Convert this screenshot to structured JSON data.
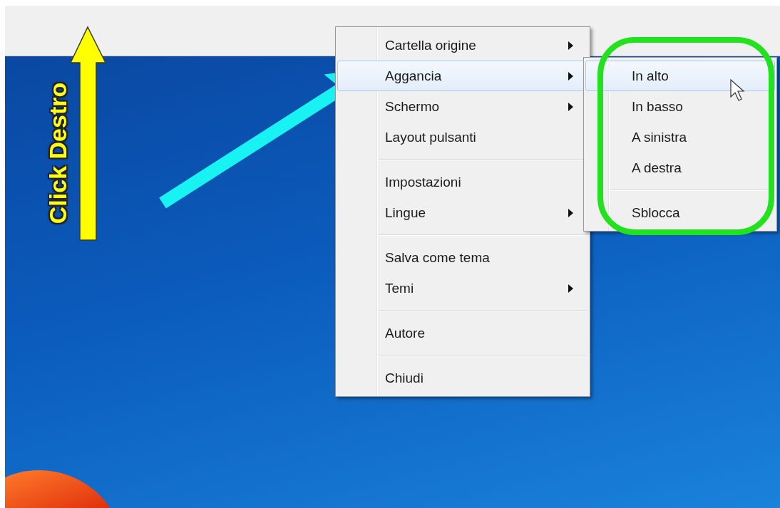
{
  "annotation": {
    "label": "Click Destro"
  },
  "context_menu": {
    "items": [
      {
        "kind": "item",
        "label": "Cartella origine",
        "has_submenu": true,
        "selected": false
      },
      {
        "kind": "item",
        "label": "Aggancia",
        "has_submenu": true,
        "selected": true
      },
      {
        "kind": "item",
        "label": "Schermo",
        "has_submenu": true,
        "selected": false
      },
      {
        "kind": "item",
        "label": "Layout pulsanti",
        "has_submenu": false,
        "selected": false
      },
      {
        "kind": "separator"
      },
      {
        "kind": "item",
        "label": "Impostazioni",
        "has_submenu": false,
        "selected": false
      },
      {
        "kind": "item",
        "label": "Lingue",
        "has_submenu": true,
        "selected": false
      },
      {
        "kind": "separator"
      },
      {
        "kind": "item",
        "label": "Salva come tema",
        "has_submenu": false,
        "selected": false
      },
      {
        "kind": "item",
        "label": "Temi",
        "has_submenu": true,
        "selected": false
      },
      {
        "kind": "separator"
      },
      {
        "kind": "item",
        "label": "Autore",
        "has_submenu": false,
        "selected": false
      },
      {
        "kind": "separator"
      },
      {
        "kind": "item",
        "label": "Chiudi",
        "has_submenu": false,
        "selected": false
      }
    ]
  },
  "submenu": {
    "items": [
      {
        "kind": "item",
        "label": "In alto",
        "selected": true
      },
      {
        "kind": "item",
        "label": "In basso",
        "selected": false
      },
      {
        "kind": "item",
        "label": "A sinistra",
        "selected": false
      },
      {
        "kind": "item",
        "label": "A destra",
        "selected": false
      },
      {
        "kind": "separator"
      },
      {
        "kind": "item",
        "label": "Sblocca",
        "selected": false
      }
    ]
  }
}
